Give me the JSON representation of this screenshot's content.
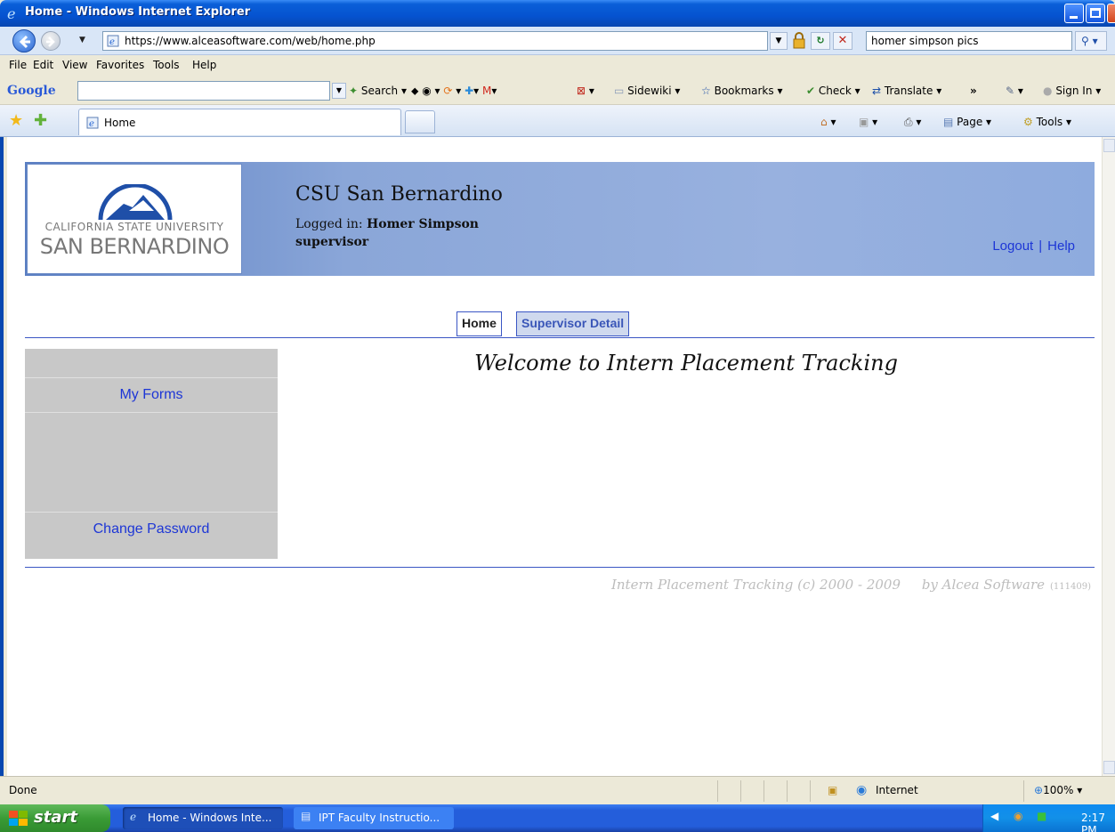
{
  "window": {
    "title": "Home - Windows Internet Explorer"
  },
  "address_bar": {
    "url": "https://www.alceasoftware.com/web/home.php",
    "search_text": "homer simpson pics"
  },
  "menu": [
    "File",
    "Edit",
    "View",
    "Favorites",
    "Tools",
    "Help"
  ],
  "google_toolbar": {
    "logo": "Google",
    "search_label": "Search",
    "sidewiki_label": "Sidewiki",
    "bookmarks_label": "Bookmarks",
    "check_label": "Check",
    "translate_label": "Translate",
    "more_label": "»",
    "signin_label": "Sign In"
  },
  "tabs": {
    "active_tab": "Home"
  },
  "command_bar": {
    "page_label": "Page",
    "tools_label": "Tools"
  },
  "page": {
    "logo_line1": "CALIFORNIA STATE UNIVERSITY",
    "logo_line2": "SAN BERNARDINO",
    "org_name": "CSU San Bernardino",
    "logged_in_prefix": "Logged in: ",
    "logged_in_user": "Homer Simpson",
    "role": "supervisor",
    "logout_label": "Logout",
    "link_separator": "|",
    "help_label": "Help",
    "tabs": [
      "Home",
      "Supervisor Detail"
    ],
    "welcome": "Welcome to Intern Placement Tracking",
    "left_nav": [
      "My Forms",
      "Change Password"
    ],
    "footer_text": "Intern Placement Tracking (c) 2000 - 2009     by Alcea Software",
    "footer_version": "(111409)"
  },
  "status_bar": {
    "status": "Done",
    "zone": "Internet",
    "zoom": "100%"
  },
  "taskbar": {
    "start_label": "start",
    "items": [
      "Home - Windows Inte...",
      "IPT Faculty Instructio..."
    ],
    "clock": "2:17 PM"
  },
  "colors": {
    "link": "#1d36d6",
    "banner": "#8aa6d8",
    "rule": "#3a56c4",
    "nav_bg": "#c8c8c8"
  }
}
